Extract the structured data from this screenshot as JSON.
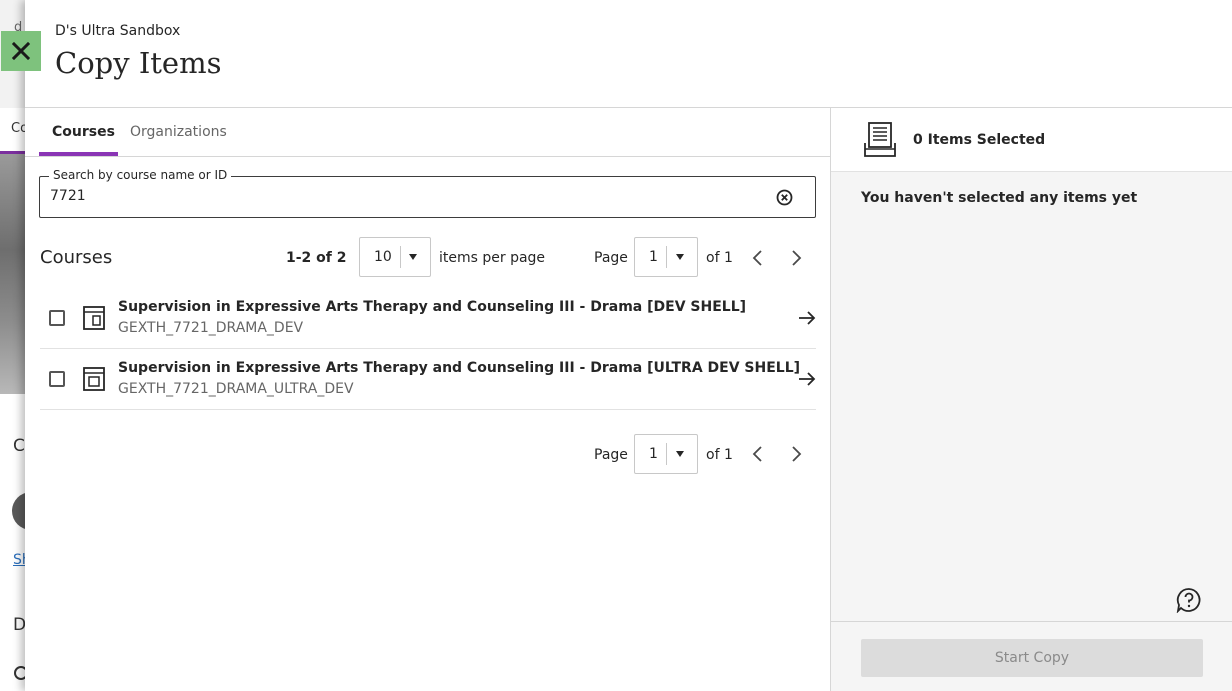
{
  "background": {
    "top_text": "d",
    "tab_text": "Co",
    "section_letter": "C",
    "link_text": "Sh",
    "section_letter2": "D"
  },
  "header": {
    "subtitle": "D's Ultra Sandbox",
    "title": "Copy Items",
    "close_icon": "close-x-icon"
  },
  "tabs": [
    {
      "label": "Courses",
      "active": true
    },
    {
      "label": "Organizations",
      "active": false
    }
  ],
  "search": {
    "label": "Search by course name or ID",
    "value": "7721"
  },
  "list": {
    "title": "Courses",
    "range": "1-2 of 2",
    "per_page_value": "10",
    "per_page_label": "items per page",
    "page_label": "Page",
    "page_value": "1",
    "page_total": "of 1"
  },
  "courses": [
    {
      "name": "Supervision in Expressive Arts Therapy and Counseling III - Drama [DEV SHELL]",
      "id": "GEXTH_7721_DRAMA_DEV"
    },
    {
      "name": "Supervision in Expressive Arts Therapy and Counseling III - Drama [ULTRA DEV SHELL]",
      "id": "GEXTH_7721_DRAMA_ULTRA_DEV"
    }
  ],
  "selection": {
    "count_label": "0 Items Selected",
    "empty_message": "You haven't selected any items yet",
    "start_label": "Start Copy"
  },
  "colors": {
    "accent": "#8a35b5",
    "close_bg": "#7ec27d"
  }
}
